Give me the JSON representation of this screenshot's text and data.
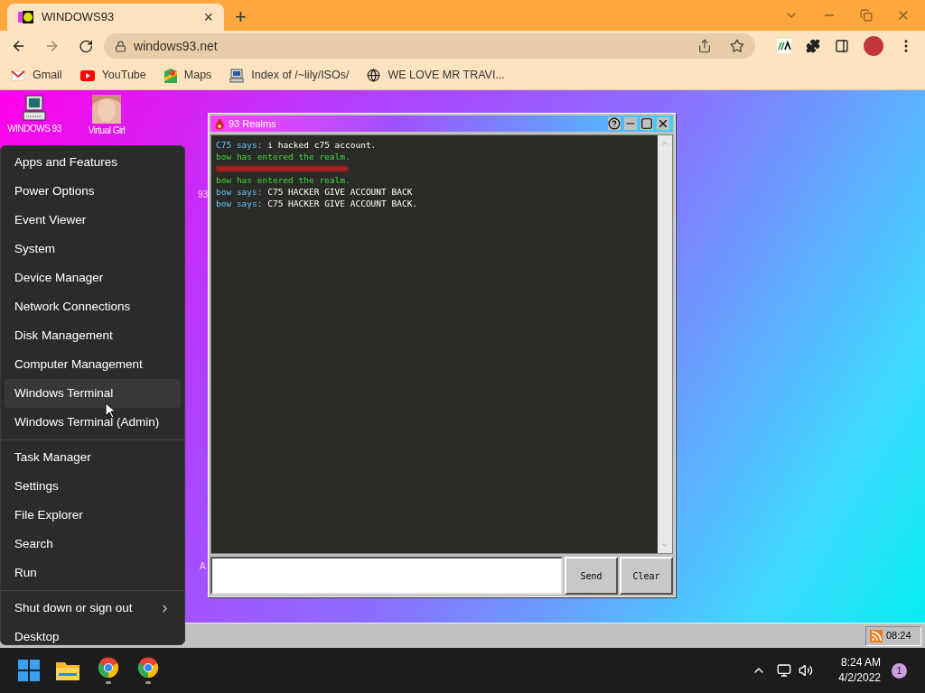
{
  "browser": {
    "tab": {
      "title": "WINDOWS93",
      "close": "×"
    },
    "new_tab": "+",
    "address": "windows93.net",
    "bookmarks": [
      {
        "kind": "gmail",
        "label": "Gmail"
      },
      {
        "kind": "youtube",
        "label": "YouTube"
      },
      {
        "kind": "maps",
        "label": "Maps"
      },
      {
        "kind": "computer",
        "label": "Index of /~lily/ISOs/"
      },
      {
        "kind": "globe",
        "label": "WE LOVE MR TRAVI..."
      }
    ]
  },
  "desktop": {
    "icons": [
      {
        "kind": "computer",
        "label": "WINDOWS 93"
      },
      {
        "kind": "portrait",
        "label": "Virtual Girl"
      }
    ],
    "fragments": [
      "93",
      "A"
    ]
  },
  "realm_window": {
    "title": "93 Realms",
    "lines": [
      {
        "kind": "chat",
        "speaker": "C75 says:",
        "text": "i hacked c75 account."
      },
      {
        "kind": "system",
        "text": "bow has entered the realm."
      },
      {
        "kind": "blurred"
      },
      {
        "kind": "system",
        "text": "bow has entered the realm."
      },
      {
        "kind": "chat",
        "speaker": "bow says:",
        "text": "C75 HACKER GIVE ACCOUNT BACK"
      },
      {
        "kind": "chat",
        "speaker": "bow says:",
        "text": "C75 HACKER GIVE ACCOUNT BACK."
      }
    ],
    "buttons": [
      "Send",
      "Clear"
    ]
  },
  "win93_taskbar": {
    "clock": "08:24"
  },
  "start_menu": {
    "groups": [
      [
        {
          "label": "Apps and Features",
          "hovered": false,
          "submenu": false
        },
        {
          "label": "Power Options",
          "hovered": false,
          "submenu": false
        },
        {
          "label": "Event Viewer",
          "hovered": false,
          "submenu": false
        },
        {
          "label": "System",
          "hovered": false,
          "submenu": false
        },
        {
          "label": "Device Manager",
          "hovered": false,
          "submenu": false
        },
        {
          "label": "Network Connections",
          "hovered": false,
          "submenu": false
        },
        {
          "label": "Disk Management",
          "hovered": false,
          "submenu": false
        },
        {
          "label": "Computer Management",
          "hovered": false,
          "submenu": false
        },
        {
          "label": "Windows Terminal",
          "hovered": true,
          "submenu": false
        },
        {
          "label": "Windows Terminal (Admin)",
          "hovered": false,
          "submenu": false
        }
      ],
      [
        {
          "label": "Task Manager",
          "hovered": false,
          "submenu": false
        },
        {
          "label": "Settings",
          "hovered": false,
          "submenu": false
        },
        {
          "label": "File Explorer",
          "hovered": false,
          "submenu": false
        },
        {
          "label": "Search",
          "hovered": false,
          "submenu": false
        },
        {
          "label": "Run",
          "hovered": false,
          "submenu": false
        }
      ],
      [
        {
          "label": "Shut down or sign out",
          "hovered": false,
          "submenu": true
        },
        {
          "label": "Desktop",
          "hovered": false,
          "submenu": false
        }
      ]
    ]
  },
  "taskbar": {
    "time": "8:24 AM",
    "date": "4/2/2022",
    "notifications": "1"
  }
}
